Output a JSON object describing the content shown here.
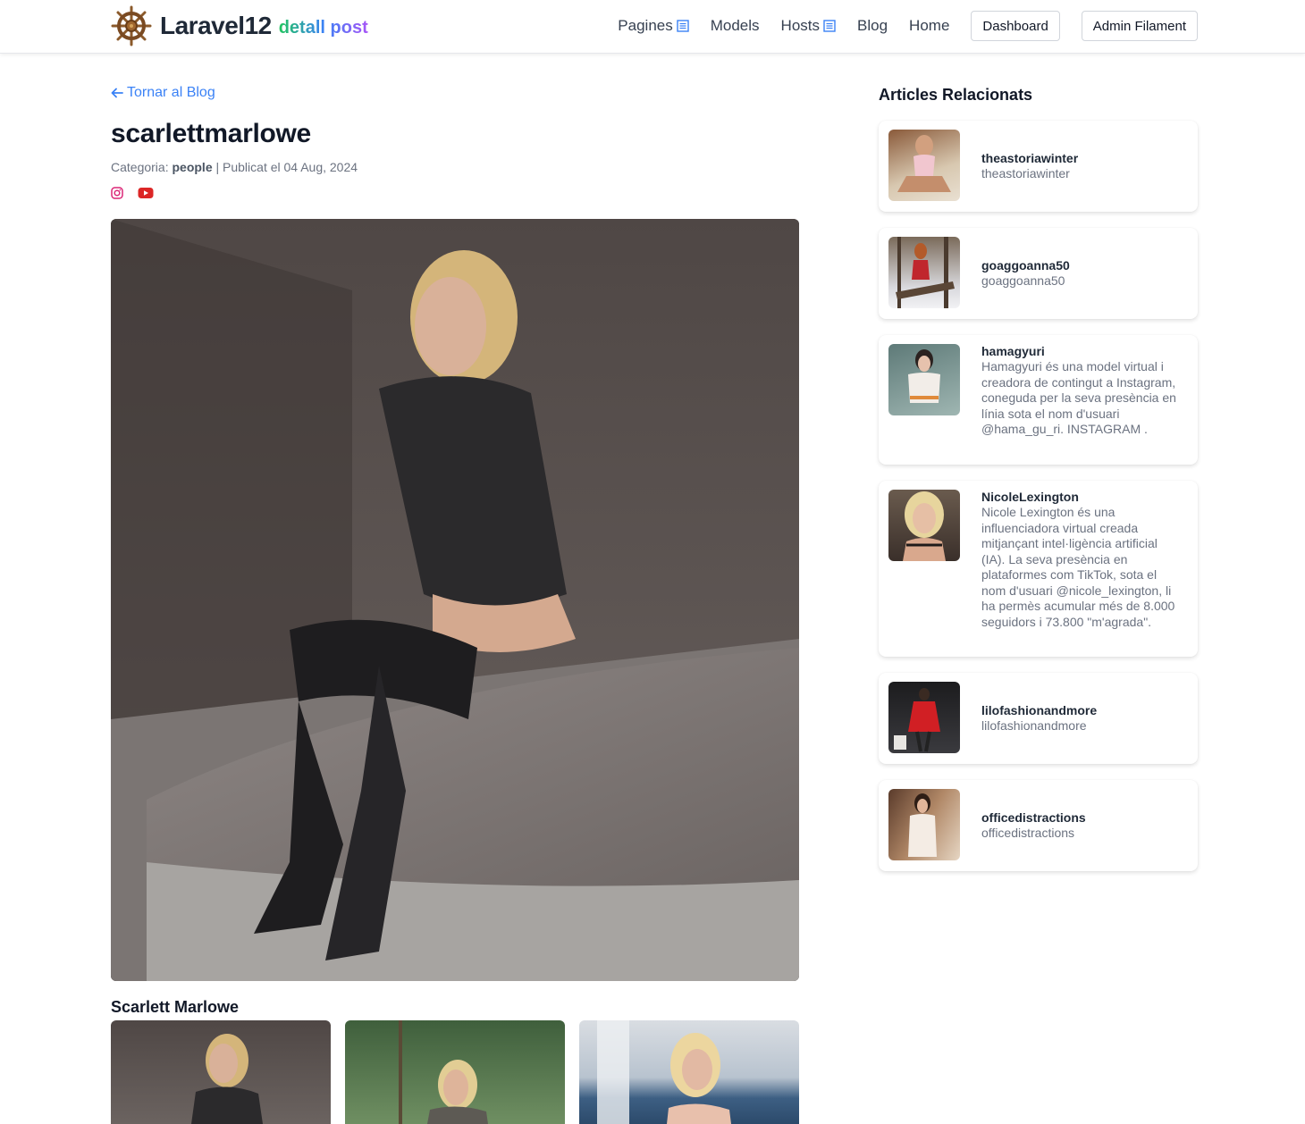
{
  "header": {
    "brand_name": "Laravel12",
    "brand_sub": "detall post",
    "nav": {
      "pagines": "Pagines",
      "models": "Models",
      "hosts": "Hosts",
      "blog": "Blog",
      "home": "Home",
      "dashboard": "Dashboard",
      "admin": "Admin Filament"
    }
  },
  "post": {
    "back_label": "Tornar al Blog",
    "title": "scarlettmarlowe",
    "category_prefix": "Categoria:",
    "category": "people",
    "published": "| Publicat el 04 Aug, 2024",
    "gallery_title": "Scarlett Marlowe"
  },
  "sidebar": {
    "title": "Articles Relacionats",
    "items": [
      {
        "title": "theastoriawinter",
        "desc": "theastoriawinter"
      },
      {
        "title": "goaggoanna50",
        "desc": "goaggoanna50"
      },
      {
        "title": "hamagyuri",
        "desc": "Hamagyuri és una model virtual i creadora de contingut a Instagram, coneguda per la seva presència en línia sota el nom d'usuari @hama_gu_ri. INSTAGRAM ."
      },
      {
        "title": "NicoleLexington",
        "desc": "Nicole Lexington és una influenciadora virtual creada mitjançant intel·ligència artificial (IA). La seva presència en plataformes com TikTok, sota el nom d'usuari @nicole_lexington, li ha permès acumular més de 8.000 seguidors i 73.800 \"m'agrada\"."
      },
      {
        "title": "lilofashionandmore",
        "desc": "lilofashionandmore"
      },
      {
        "title": "officedistractions",
        "desc": "officedistractions"
      }
    ]
  },
  "colors": {
    "link": "#3b82f6",
    "instagram": "#db2777",
    "youtube": "#dc2626"
  }
}
